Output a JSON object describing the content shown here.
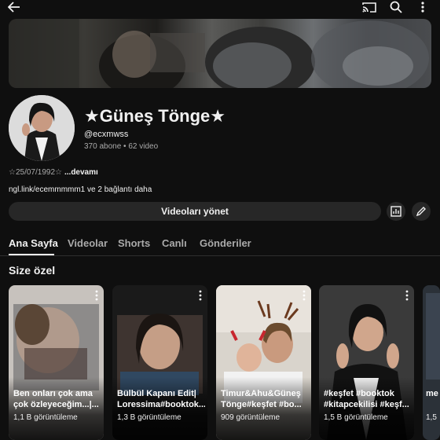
{
  "channel": {
    "name": "★Güneş Tönge★",
    "handle": "@ecxmwss",
    "meta": "370 abone • 62 video",
    "bio": "☆25/07/1992☆",
    "bio_more": "...devamı",
    "links": "ngl.link/ecemmmmm1 ve 2 bağlantı daha"
  },
  "actions": {
    "manage_label": "Videoları yönet"
  },
  "tabs": [
    {
      "label": "Ana Sayfa",
      "active": true
    },
    {
      "label": "Videolar"
    },
    {
      "label": "Shorts"
    },
    {
      "label": "Canlı"
    },
    {
      "label": "Gönderiler"
    }
  ],
  "section": {
    "title": "Size özel"
  },
  "shorts": [
    {
      "title": "Ben onları çok ama çok özleyeceğim...|...",
      "views": "1,1 B görüntüleme"
    },
    {
      "title": "Bülbül Kapanı Edit| Loressima#booktok...",
      "views": "1,3 B görüntüleme"
    },
    {
      "title": "Timur&Ahu&Güneş Tönge#keşfet #bo...",
      "views": "909 görüntüleme"
    },
    {
      "title": "#keşfet #booktok #kitapcekilisi #keşf...",
      "views": "1,5 B görüntüleme"
    },
    {
      "title": "me",
      "views": "1,5"
    }
  ],
  "icons": {
    "back": "arrow-left-icon",
    "cast": "cast-icon",
    "search": "search-icon",
    "more": "more-vert-icon",
    "analytics": "analytics-icon",
    "edit": "pencil-icon"
  }
}
